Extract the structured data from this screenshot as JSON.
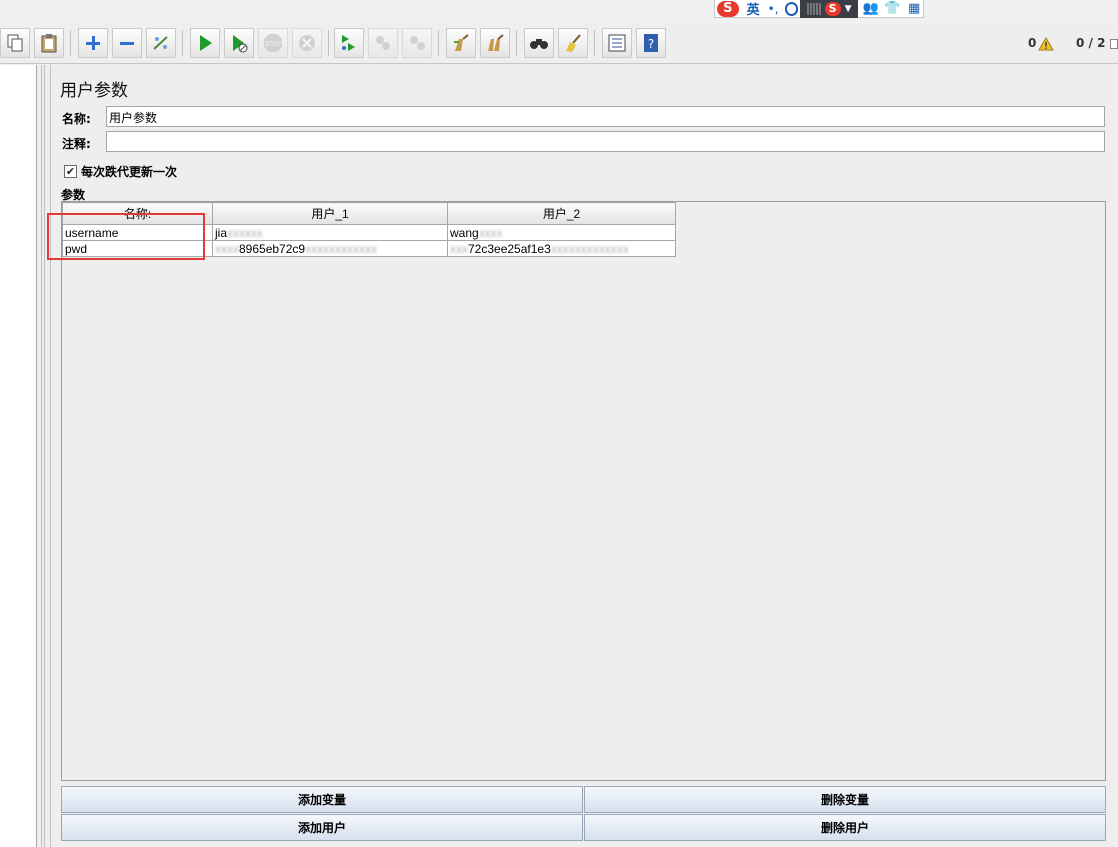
{
  "ime": {
    "brand_glyph": "S",
    "mode_label": "英",
    "punct": "•,"
  },
  "status": {
    "warnings": "0",
    "threads": "0 / 2"
  },
  "panel": {
    "title": "用户参数",
    "name_label": "名称:",
    "name_value": "用户参数",
    "comment_label": "注释:",
    "comment_value": "",
    "update_once_label": "每次跌代更新一次",
    "update_once_checked": true,
    "params_label": "参数"
  },
  "table": {
    "headers": [
      "名称:",
      "用户_1",
      "用户_2"
    ],
    "rows": [
      [
        "username",
        "jia",
        "wang"
      ],
      [
        "pwd",
        "8965eb72c9",
        "72c3ee25af1e3"
      ]
    ]
  },
  "buttons": {
    "add_variable": "添加变量",
    "delete_variable": "删除变量",
    "add_user": "添加用户",
    "delete_user": "删除用户"
  },
  "colors": {
    "highlight": "#e23a3a",
    "run_green": "#1e9a2a"
  }
}
